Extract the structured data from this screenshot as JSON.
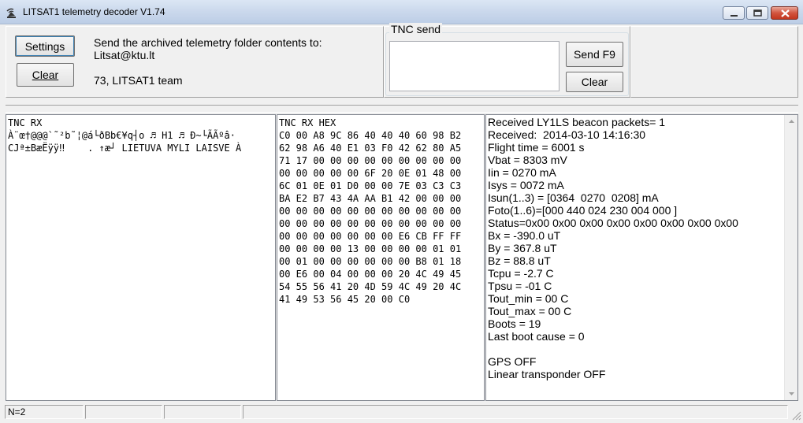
{
  "window": {
    "title": "LITSAT1 telemetry decoder V1.74"
  },
  "toolbar": {
    "settings_label": "Settings",
    "clear_label": "Clear",
    "message_line1": "Send the archived telemetry folder contents to:",
    "message_line2": "Litsat@ktu.lt",
    "message_line3": "73, LITSAT1 team"
  },
  "tnc_send": {
    "group_label": "TNC send",
    "input_value": "",
    "send_label": "Send F9",
    "clear_label": "Clear"
  },
  "tnc_rx": {
    "header": "TNC RX",
    "lines": [
      "À¨œ†@@@`˜²b˜¦@á└ðBb€¥q┤o ♬ H1 ♬ Ð~└ÃÃºâ·",
      "CJª±BæËÿÿ‼    . ↑æ┘ LIETUVA MYLI LAISVE À"
    ]
  },
  "tnc_rx_hex": {
    "header": "TNC RX HEX",
    "lines": [
      "C0 00 A8 9C 86 40 40 40 60 98 B2",
      "62 98 A6 40 E1 03 F0 42 62 80 A5",
      "71 17 00 00 00 00 00 00 00 00 00",
      "00 00 00 00 00 6F 20 0E 01 48 00",
      "6C 01 0E 01 D0 00 00 7E 03 C3 C3",
      "BA E2 B7 43 4A AA B1 42 00 00 00",
      "00 00 00 00 00 00 00 00 00 00 00",
      "00 00 00 00 00 00 00 00 00 00 00",
      "00 00 00 00 00 00 00 E6 CB FF FF",
      "00 00 00 00 13 00 00 00 00 01 01",
      "00 01 00 00 00 00 00 00 B8 01 18",
      "00 E6 00 04 00 00 00 20 4C 49 45",
      "54 55 56 41 20 4D 59 4C 49 20 4C",
      "41 49 53 56 45 20 00 C0"
    ]
  },
  "telemetry": {
    "lines": [
      "Received LY1LS beacon packets= 1",
      "Received:  2014-03-10 14:16:30",
      "Flight time = 6001 s",
      "Vbat = 8303 mV",
      "Iin = 0270 mA",
      "Isys = 0072 mA",
      "Isun(1..3) = [0364  0270  0208] mA",
      "Foto(1..6)=[000 440 024 230 004 000 ]",
      "Status=0x00 0x00 0x00 0x00 0x00 0x00 0x00 0x00",
      "Bx = -390.0 uT",
      "By = 367.8 uT",
      "Bz = 88.8 uT",
      "Tcpu = -2.7 C",
      "Tpsu = -01 C",
      "Tout_min = 00 C",
      "Tout_max = 00 C",
      "Boots = 19",
      "Last boot cause = 0",
      "",
      "GPS OFF",
      "Linear transponder OFF"
    ]
  },
  "statusbar": {
    "cell1": "N=2",
    "cell2": "",
    "cell3": "",
    "cell4": ""
  },
  "icons": {
    "app": "satellite-dish-icon",
    "minimize": "minimize-icon",
    "maximize": "maximize-icon",
    "close": "close-icon"
  }
}
